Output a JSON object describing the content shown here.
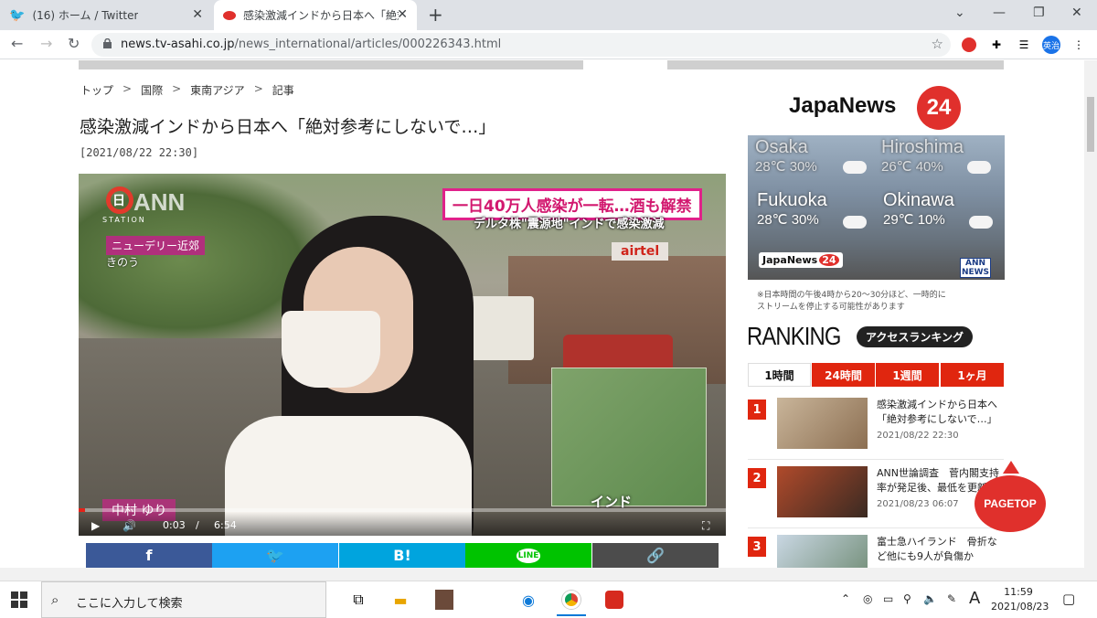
{
  "browser": {
    "tabs": [
      {
        "title": "(16) ホーム / Twitter",
        "icon": "twitter-icon"
      },
      {
        "title": "感染激減インドから日本へ「絶対参考",
        "icon": "tv-asahi-icon"
      }
    ],
    "url_host": "news.tv-asahi.co.jp",
    "url_path": "/news_international/articles/000226343.html",
    "profile_label": "英治"
  },
  "breadcrumb": [
    "トップ",
    "国際",
    "東南アジア",
    "記事"
  ],
  "breadcrumb_sep": ">",
  "article": {
    "title": "感染激減インドから日本へ「絶対参考にしないで…」",
    "date": "[2021/08/22 22:30]"
  },
  "video": {
    "headline_top": "一日40万人感染が一転…酒も解禁",
    "headline_sub": "デルタ株\"震源地\"インドで感染激減",
    "location": "ニューデリー近郊",
    "when": "きのう",
    "station_label": "STATION",
    "ann_text": "ANN",
    "hi_text": "日",
    "shop_sign": "airtel",
    "map_label": "インド",
    "reporter": "中村 ゆり",
    "current_time": "0:03",
    "duration": "6:54",
    "time_sep": "/",
    "progress": 0.01
  },
  "share": [
    {
      "label": "f",
      "color": "#3b5998",
      "icon": "facebook-icon"
    },
    {
      "label": "🐦",
      "color": "#1da1f2",
      "icon": "twitter-icon"
    },
    {
      "label": "B!",
      "color": "#00a4de",
      "icon": "hatena-bookmark-icon"
    },
    {
      "label": "LINE",
      "color": "#00c300",
      "icon": "line-icon"
    },
    {
      "label": "🔗",
      "color": "#4c4c4c",
      "icon": "link-icon"
    }
  ],
  "japanews": {
    "logo": "JapaNews",
    "logo_24": "24",
    "weather": [
      {
        "city": "Osaka",
        "temp": "28℃ 30%"
      },
      {
        "city": "Hiroshima",
        "temp": "26℃ 40%"
      },
      {
        "city": "Fukuoka",
        "temp": "28℃ 30%"
      },
      {
        "city": "Okinawa",
        "temp": "29℃ 10%"
      }
    ],
    "badge": "ANN NEWS",
    "note": "※日本時間の午後4時から20～30分ほど、一時的にストリームを停止する可能性があります"
  },
  "ranking": {
    "title": "RANKING",
    "badge": "アクセスランキング",
    "tabs": [
      "1時間",
      "24時間",
      "1週間",
      "1ヶ月"
    ],
    "active_tab": 0,
    "items": [
      {
        "rank": "1",
        "title": "感染激減インドから日本へ「絶対参考にしないで…」",
        "date": "2021/08/22 22:30"
      },
      {
        "rank": "2",
        "title": "ANN世論調査　菅内閣支持率が発足後、最低を更新",
        "date": "2021/08/23 06:07"
      },
      {
        "rank": "3",
        "title": "富士急ハイランド　骨折など他にも9人が負傷か",
        "date": ""
      }
    ]
  },
  "pagetop_label": "PAGETOP",
  "taskbar": {
    "search_placeholder": "ここに入力して検索",
    "time": "11:59",
    "date": "2021/08/23",
    "ime": "A"
  }
}
